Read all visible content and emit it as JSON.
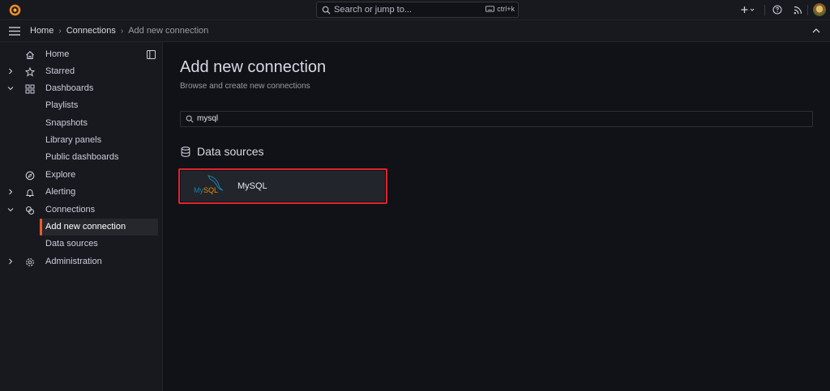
{
  "topbar": {
    "search_placeholder": "Search or jump to...",
    "search_shortcut": "ctrl+k",
    "new_icon": "plus-icon",
    "help_icon": "help-icon",
    "news_icon": "rss-icon"
  },
  "breadcrumb": {
    "items": [
      "Home",
      "Connections",
      "Add new connection"
    ]
  },
  "sidebar": {
    "items": [
      {
        "label": "Home",
        "icon": "home-icon",
        "expandable": false
      },
      {
        "label": "Starred",
        "icon": "star-icon",
        "expandable": true,
        "expanded": false
      },
      {
        "label": "Dashboards",
        "icon": "apps-icon",
        "expandable": true,
        "expanded": true
      },
      {
        "label": "Playlists",
        "child": true
      },
      {
        "label": "Snapshots",
        "child": true
      },
      {
        "label": "Library panels",
        "child": true
      },
      {
        "label": "Public dashboards",
        "child": true
      },
      {
        "label": "Explore",
        "icon": "compass-icon",
        "expandable": false
      },
      {
        "label": "Alerting",
        "icon": "bell-icon",
        "expandable": true,
        "expanded": false
      },
      {
        "label": "Connections",
        "icon": "connections-icon",
        "expandable": true,
        "expanded": true
      },
      {
        "label": "Add new connection",
        "child": true,
        "active": true
      },
      {
        "label": "Data sources",
        "child": true
      },
      {
        "label": "Administration",
        "icon": "cog-icon",
        "expandable": true,
        "expanded": false
      }
    ]
  },
  "main": {
    "title": "Add new connection",
    "subtitle": "Browse and create new connections",
    "search_value": "mysql",
    "section_title": "Data sources",
    "cards": [
      {
        "name": "MySQL",
        "logo_my": "My",
        "logo_sql": "SQL"
      }
    ]
  },
  "colors": {
    "accent": "#f05a28",
    "highlight_outline": "#e0232b",
    "background": "#111217",
    "panel": "#18191e"
  }
}
